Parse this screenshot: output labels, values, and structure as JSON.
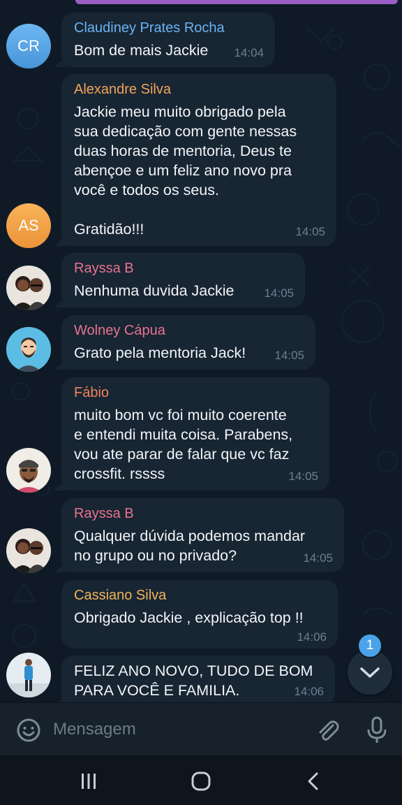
{
  "messages": [
    {
      "sender": "Claudiney Prates Rocha",
      "sender_color": "#6ab3f3",
      "text": "Bom de mais Jackie",
      "time": "14:04",
      "avatar": {
        "type": "initials",
        "initials": "CR"
      }
    },
    {
      "sender": "Alexandre Silva",
      "sender_color": "#f0a55a",
      "text": "Jackie meu muito obrigado pela\nsua dedicação com gente nessas\nduas horas de mentoria, Deus te\nabençoe e um feliz ano novo pra\nvocê e todos os seus.\n\nGratidão!!!",
      "time": "14:05",
      "avatar": {
        "type": "initials",
        "initials": "AS"
      }
    },
    {
      "sender": "Rayssa B",
      "sender_color": "#e8738f",
      "text": "Nenhuma duvida Jackie",
      "time": "14:05",
      "avatar": {
        "type": "photo",
        "icon": "couple-photo-icon"
      }
    },
    {
      "sender": "Wolney Cápua",
      "sender_color": "#e8738f",
      "text": "Grato pela mentoria Jack!",
      "time": "14:05",
      "avatar": {
        "type": "photo",
        "icon": "bearded-man-illustration-icon"
      }
    },
    {
      "sender": "Fábio",
      "sender_color": "#f0845a",
      "text": "muito bom vc foi muito coerente\ne entendi muita coisa. Parabens,\nvou ate parar de falar que vc faz\ncrossfit. rssss",
      "time": "14:05",
      "avatar": {
        "type": "photo",
        "icon": "man-with-cap-photo-icon"
      }
    },
    {
      "sender": "Rayssa B",
      "sender_color": "#e8738f",
      "text": "Qualquer dúvida podemos mandar\nno grupo ou no privado?",
      "time": "14:05",
      "avatar": {
        "type": "photo",
        "icon": "couple-photo-icon"
      }
    },
    {
      "sender": "Cassiano Silva",
      "sender_color": "#f0b45a",
      "text": "Obrigado Jackie , explicação top !!",
      "time": "14:06",
      "avatar": null
    },
    {
      "sender": "",
      "sender_color": "#6ab3f3",
      "text": "FELIZ ANO NOVO, TUDO DE BOM\nPARA VOCÊ E FAMILIA.",
      "time": "14:06",
      "avatar": {
        "type": "photo",
        "icon": "person-in-snow-photo-icon"
      }
    }
  ],
  "scroll_down": {
    "badge": "1",
    "icon": "chevron-down-icon"
  },
  "composer": {
    "placeholder": "Mensagem",
    "emoji_icon": "smiley-icon",
    "attach_icon": "paperclip-icon",
    "mic_icon": "microphone-icon"
  },
  "navbar": {
    "icons": [
      "recent-apps-icon",
      "home-icon",
      "back-icon"
    ]
  },
  "colors": {
    "background": "#0e1621",
    "bubble": "#182533",
    "time": "#6d7f8f",
    "accent": "#4aa3e8"
  }
}
